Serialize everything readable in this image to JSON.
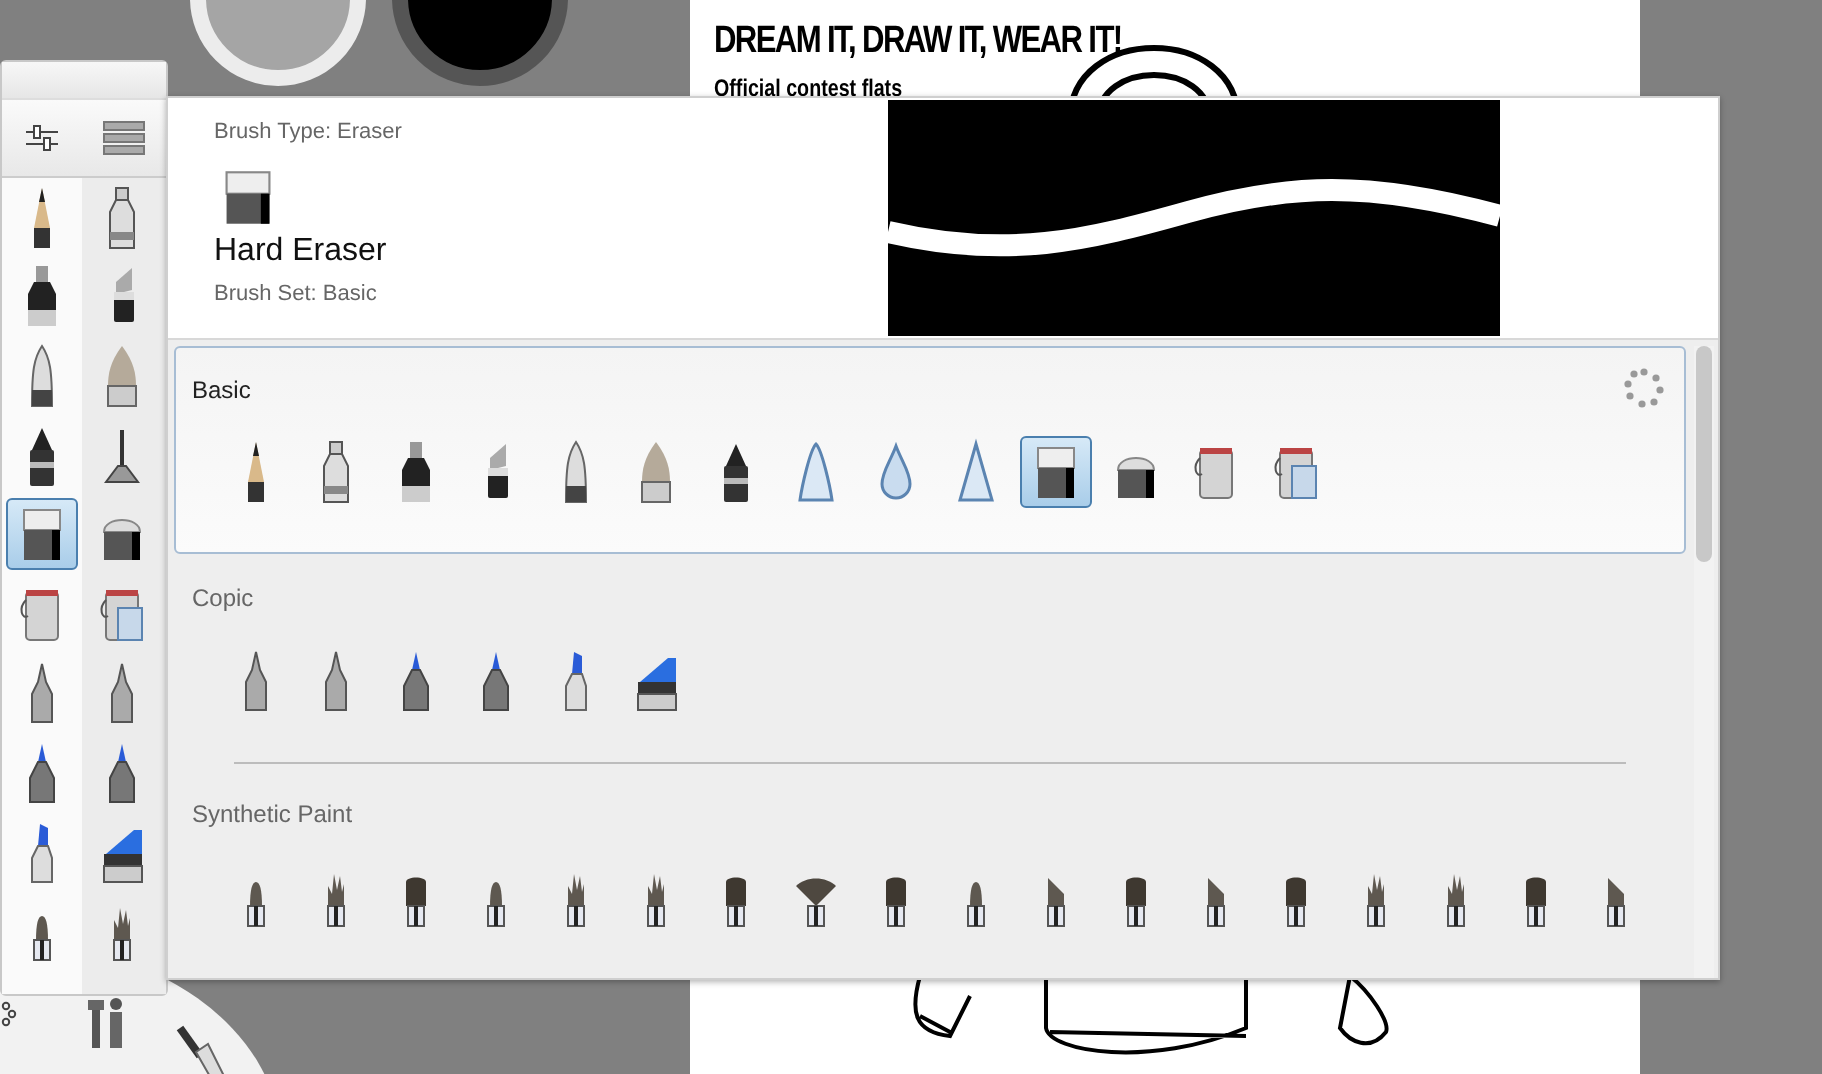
{
  "canvas": {
    "title": "DREAM IT, DRAW IT, WEAR IT!",
    "subtitle": "Official contest flats"
  },
  "palette": {
    "brushes": [
      {
        "kind": "pencil",
        "selected": false
      },
      {
        "kind": "tube",
        "selected": false
      },
      {
        "kind": "marker",
        "selected": false
      },
      {
        "kind": "chisel",
        "selected": false
      },
      {
        "kind": "ballpoint",
        "selected": false
      },
      {
        "kind": "brushtip",
        "selected": false
      },
      {
        "kind": "inkpen",
        "selected": false
      },
      {
        "kind": "needle",
        "selected": false
      },
      {
        "kind": "eraser",
        "selected": true
      },
      {
        "kind": "softeraser",
        "selected": false
      },
      {
        "kind": "bucket",
        "selected": false
      },
      {
        "kind": "bucketlayer",
        "selected": false
      },
      {
        "kind": "copicpen",
        "selected": false
      },
      {
        "kind": "copicpen",
        "selected": false
      },
      {
        "kind": "copicblue",
        "selected": false
      },
      {
        "kind": "copicblue",
        "selected": false
      },
      {
        "kind": "copicchisel",
        "selected": false
      },
      {
        "kind": "copicwide",
        "selected": false
      },
      {
        "kind": "round",
        "selected": false
      },
      {
        "kind": "spiky",
        "selected": false
      }
    ]
  },
  "brush_library": {
    "brush_type": "Brush Type: Eraser",
    "brush_name": "Hard Eraser",
    "brush_set": "Brush Set: Basic",
    "sets": [
      {
        "name": "Basic",
        "selected": true,
        "brushes": [
          {
            "kind": "pencil",
            "selected": false
          },
          {
            "kind": "tube",
            "selected": false
          },
          {
            "kind": "marker",
            "selected": false
          },
          {
            "kind": "chisel",
            "selected": false
          },
          {
            "kind": "ballpoint",
            "selected": false
          },
          {
            "kind": "brushtip",
            "selected": false
          },
          {
            "kind": "inkpen",
            "selected": false
          },
          {
            "kind": "airbrush",
            "selected": false
          },
          {
            "kind": "drop",
            "selected": false
          },
          {
            "kind": "cone",
            "selected": false
          },
          {
            "kind": "eraser",
            "selected": true
          },
          {
            "kind": "softeraser",
            "selected": false
          },
          {
            "kind": "bucket",
            "selected": false
          },
          {
            "kind": "bucketlayer",
            "selected": false
          }
        ]
      },
      {
        "name": "Copic",
        "selected": false,
        "brushes": [
          {
            "kind": "copicpen",
            "selected": false
          },
          {
            "kind": "copicpen",
            "selected": false
          },
          {
            "kind": "copicblue",
            "selected": false
          },
          {
            "kind": "copicblue",
            "selected": false
          },
          {
            "kind": "copicchisel",
            "selected": false
          },
          {
            "kind": "copicwide",
            "selected": false
          }
        ]
      },
      {
        "name": "Synthetic Paint",
        "selected": false,
        "brushes": [
          {
            "kind": "round",
            "selected": false
          },
          {
            "kind": "spiky",
            "selected": false
          },
          {
            "kind": "flat",
            "selected": false
          },
          {
            "kind": "round",
            "selected": false
          },
          {
            "kind": "spiky",
            "selected": false
          },
          {
            "kind": "spiky",
            "selected": false
          },
          {
            "kind": "flat",
            "selected": false
          },
          {
            "kind": "fan",
            "selected": false
          },
          {
            "kind": "flat",
            "selected": false
          },
          {
            "kind": "round",
            "selected": false
          },
          {
            "kind": "angled",
            "selected": false
          },
          {
            "kind": "flat",
            "selected": false
          },
          {
            "kind": "angled",
            "selected": false
          },
          {
            "kind": "flat",
            "selected": false
          },
          {
            "kind": "spiky",
            "selected": false
          },
          {
            "kind": "spiky",
            "selected": false
          },
          {
            "kind": "flat",
            "selected": false
          },
          {
            "kind": "angled",
            "selected": false
          }
        ]
      }
    ]
  }
}
